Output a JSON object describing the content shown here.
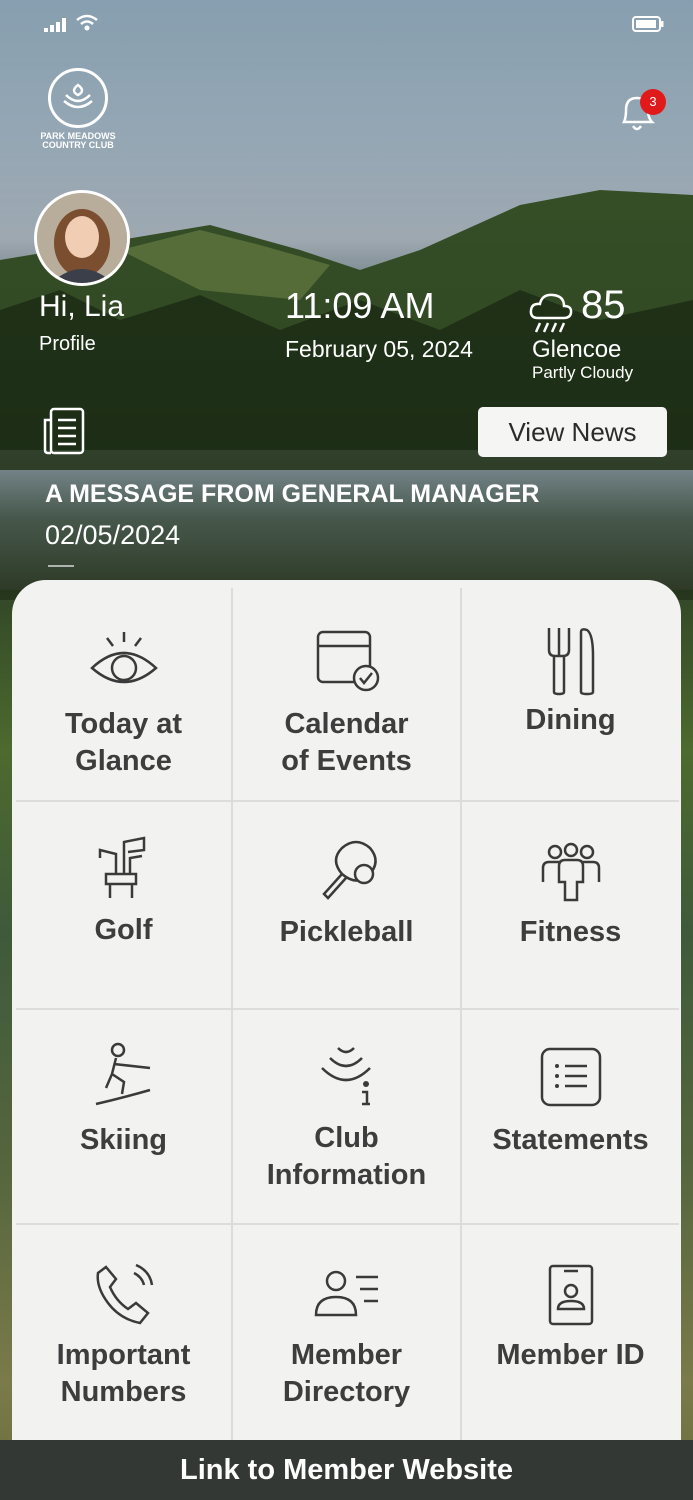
{
  "header": {
    "logo_text_line1": "PARK MEADOWS",
    "logo_text_line2": "COUNTRY CLUB",
    "notification_count": "3"
  },
  "user": {
    "greeting": "Hi, Lia",
    "profile_label": "Profile"
  },
  "clock": {
    "time": "11:09 AM",
    "date": "February  05, 2024"
  },
  "weather": {
    "temp": "85",
    "city": "Glencoe",
    "condition": "Partly Cloudy",
    "icon": "rain-cloud-icon"
  },
  "news": {
    "button_label": "View News",
    "title": "A MESSAGE FROM GENERAL MANAGER",
    "date": "02/05/2024"
  },
  "menu": [
    {
      "line1": "Today at",
      "line2": "Glance",
      "icon": "eye-icon"
    },
    {
      "line1": "Calendar",
      "line2": "of Events",
      "icon": "calendar-check-icon"
    },
    {
      "line1": "Dining",
      "line2": "",
      "icon": "fork-knife-icon"
    },
    {
      "line1": "Golf",
      "line2": "",
      "icon": "golf-clubs-icon"
    },
    {
      "line1": "Pickleball",
      "line2": "",
      "icon": "pickleball-paddle-icon"
    },
    {
      "line1": "Fitness",
      "line2": "",
      "icon": "group-people-icon"
    },
    {
      "line1": "Skiing",
      "line2": "",
      "icon": "skier-icon"
    },
    {
      "line1": "Club",
      "line2": "Information",
      "icon": "club-info-icon"
    },
    {
      "line1": "Statements",
      "line2": "",
      "icon": "statement-list-icon"
    },
    {
      "line1": "Important",
      "line2": "Numbers",
      "icon": "phone-icon"
    },
    {
      "line1": "Member",
      "line2": "Directory",
      "icon": "member-directory-icon"
    },
    {
      "line1": "Member ID",
      "line2": "",
      "icon": "id-badge-icon"
    }
  ],
  "footer": {
    "label": "Link to Member Website"
  },
  "colors": {
    "footer_bg": "#333835",
    "panel_bg": "#f2f2f1",
    "badge": "#e01a1a"
  }
}
